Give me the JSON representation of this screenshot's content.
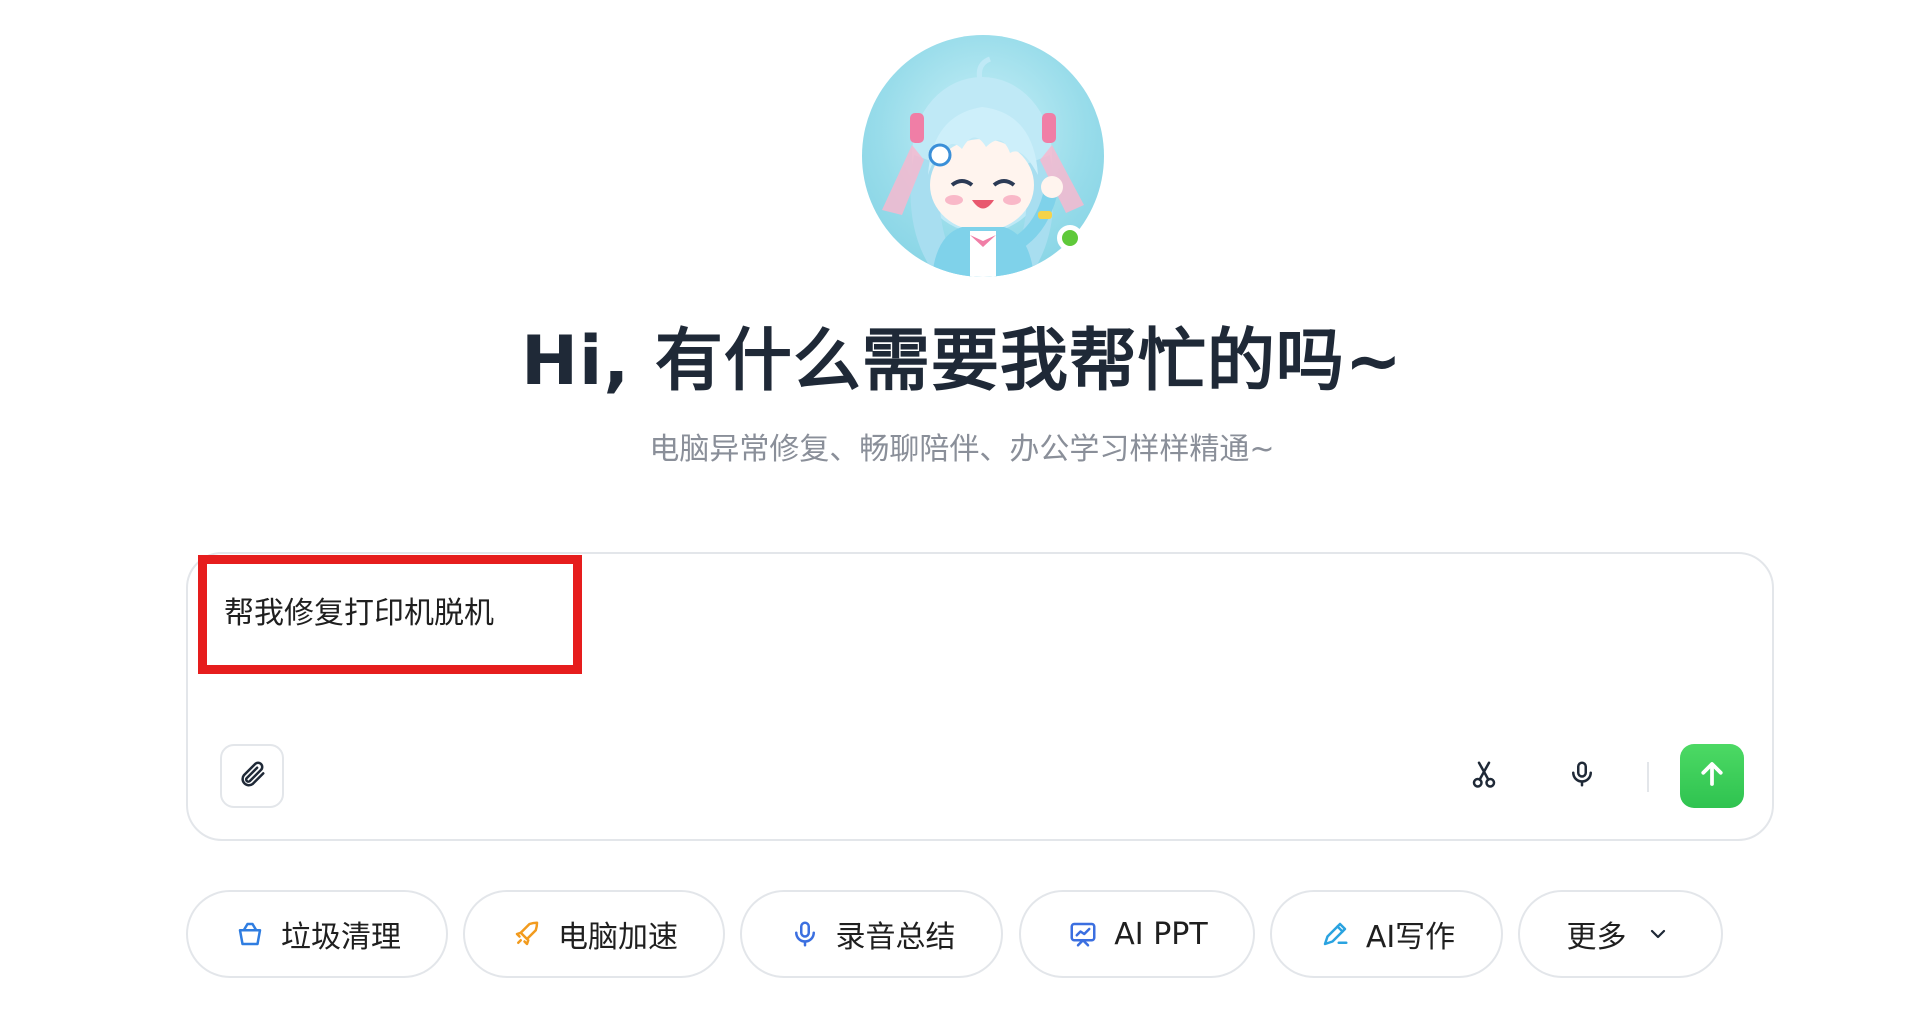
{
  "header": {
    "title": "Hi, 有什么需要我帮忙的吗~",
    "subtitle": "电脑异常修复、畅聊陪伴、办公学习样样精通~"
  },
  "avatar": {
    "status": "online",
    "status_color": "#5fc93a"
  },
  "chat_input": {
    "value": "帮我修复打印机脱机",
    "attach_icon": "paperclip-icon",
    "screenshot_icon": "scissors-icon",
    "voice_icon": "microphone-icon",
    "send_icon": "arrow-up-icon",
    "send_color": "#3cce5a",
    "highlight_color": "#e61d1d"
  },
  "quick_actions": [
    {
      "label": "垃圾清理",
      "icon": "trash-basket-icon"
    },
    {
      "label": "电脑加速",
      "icon": "rocket-icon"
    },
    {
      "label": "录音总结",
      "icon": "microphone-icon"
    },
    {
      "label": "AI PPT",
      "icon": "presentation-icon"
    },
    {
      "label": "AI写作",
      "icon": "pen-icon"
    },
    {
      "label": "更多",
      "icon": "chevron-down-icon"
    }
  ]
}
